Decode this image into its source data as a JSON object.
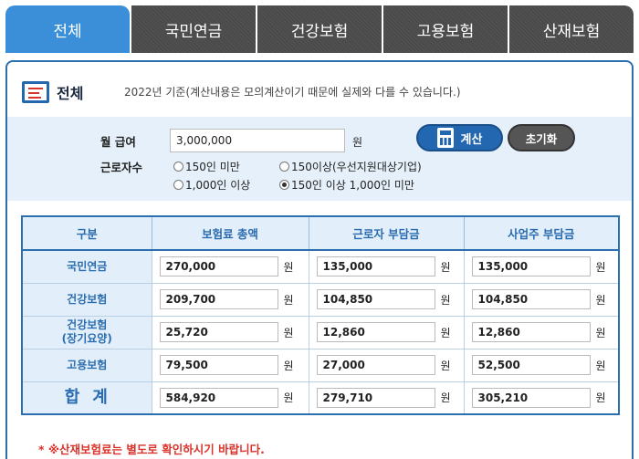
{
  "tabs": [
    {
      "label": "전체",
      "active": true
    },
    {
      "label": "국민연금",
      "active": false
    },
    {
      "label": "건강보험",
      "active": false
    },
    {
      "label": "고용보험",
      "active": false
    },
    {
      "label": "산재보험",
      "active": false
    }
  ],
  "panel": {
    "title": "전체",
    "notice": "2022년 기준(계산내용은 모의계산이기 때문에 실제와 다를 수 있습니다.)"
  },
  "form": {
    "salary_label": "월 급여",
    "salary_value": "3,000,000",
    "salary_unit": "원",
    "workers_label": "근로자수",
    "options": [
      {
        "label": "150인 미만",
        "selected": false
      },
      {
        "label": "150이상(우선지원대상기업)",
        "selected": false
      },
      {
        "label": "1,000인 이상",
        "selected": false
      },
      {
        "label": "150인 이상 1,000인 미만",
        "selected": true
      }
    ],
    "calc_label": "계산",
    "reset_label": "초기화"
  },
  "table": {
    "headers": [
      "구분",
      "보험료 총액",
      "근로자 부담금",
      "사업주 부담금"
    ],
    "unit": "원",
    "rows": [
      {
        "name": "국민연금",
        "total": "270,000",
        "worker": "135,000",
        "employer": "135,000"
      },
      {
        "name": "건강보험",
        "total": "209,700",
        "worker": "104,850",
        "employer": "104,850"
      },
      {
        "name": "건강보험",
        "sub": "(장기요양)",
        "total": "25,720",
        "worker": "12,860",
        "employer": "12,860"
      },
      {
        "name": "고용보험",
        "total": "79,500",
        "worker": "27,000",
        "employer": "52,500"
      },
      {
        "name": "합계",
        "total": "584,920",
        "worker": "279,710",
        "employer": "305,210"
      }
    ]
  },
  "footnote": "* ※산재보험료는 별도로 확인하시기 바랍니다.",
  "colors": {
    "accent": "#3a8fd8",
    "header_text": "#2a6cb0",
    "warning": "#d9342b",
    "tab_bg": "#4a4a4a"
  }
}
